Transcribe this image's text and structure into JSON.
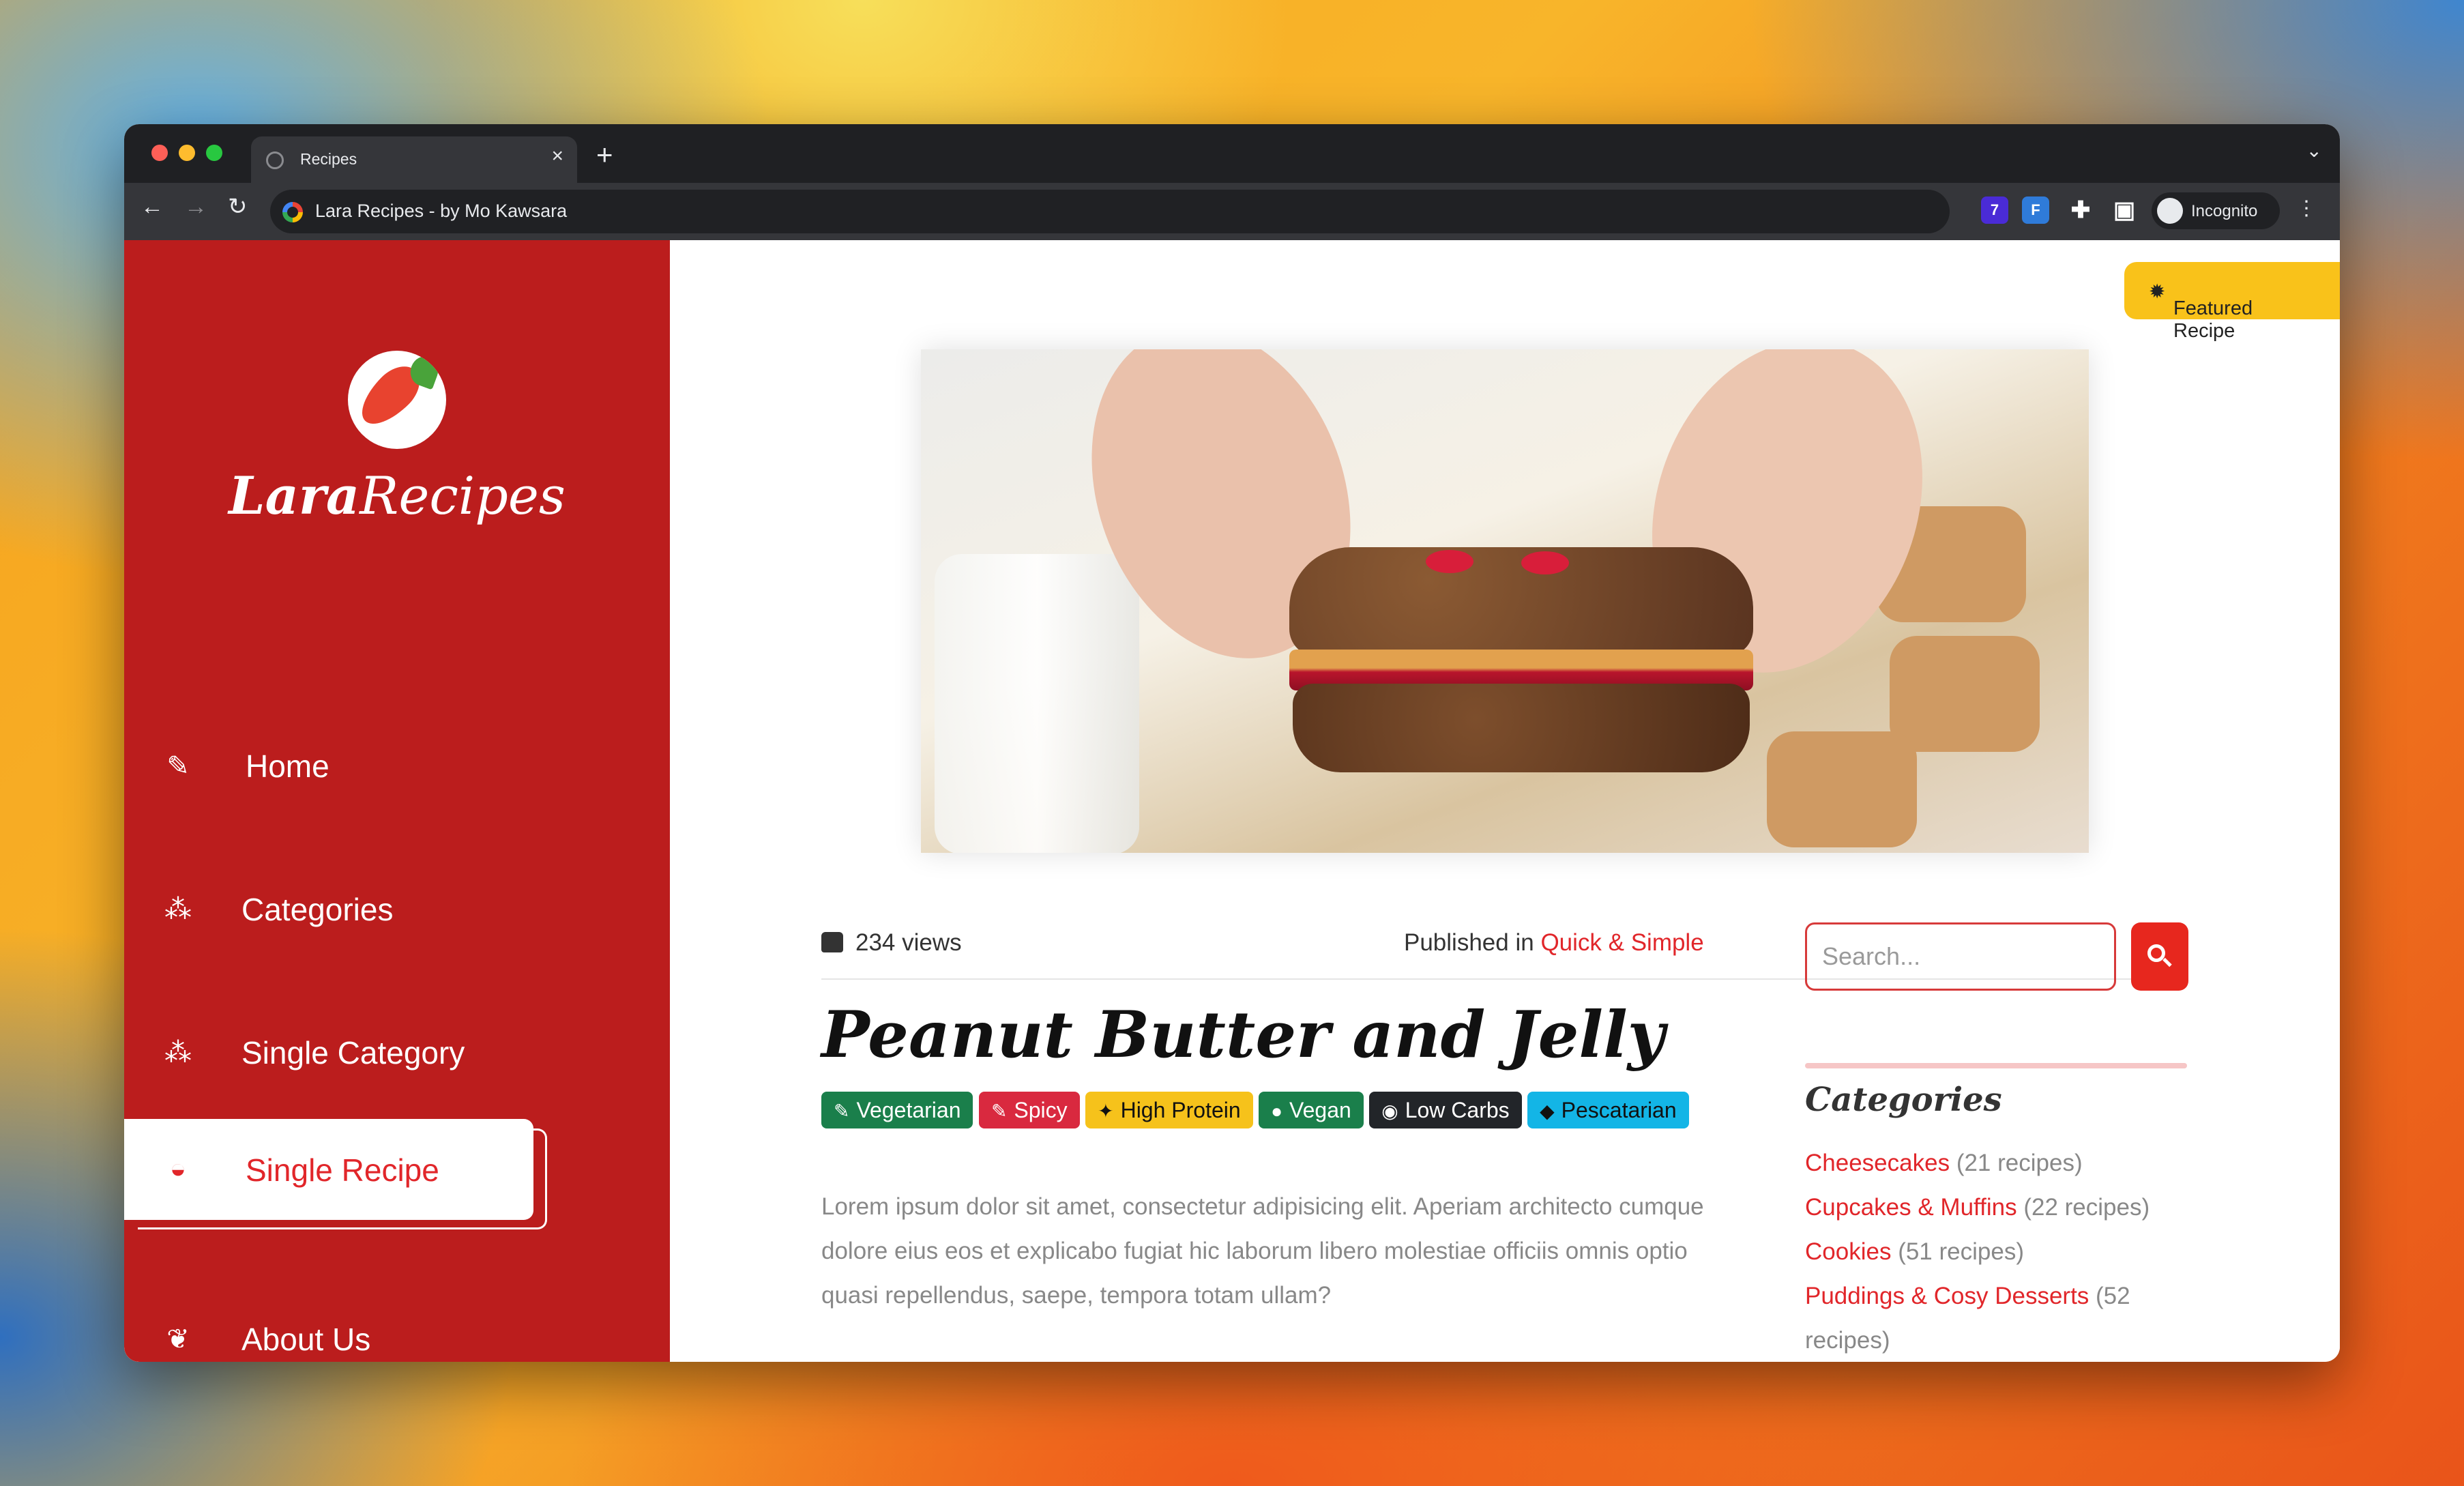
{
  "browser": {
    "tab_title": "Recipes",
    "new_tab": "+",
    "tab_close": "×",
    "address": "Lara Recipes - by Mo Kawsara",
    "incognito_label": "Incognito",
    "extensions": [
      {
        "name": "extension-badge",
        "label": "7",
        "color": "#4a2bd6"
      },
      {
        "name": "extension-fl",
        "label": "F",
        "color": "#2f7bd9"
      }
    ]
  },
  "sidebar": {
    "brand_bold": "Lara",
    "brand_regular": "Recipes",
    "items": [
      {
        "label": "Home",
        "icon": "carrot-icon",
        "glyph": "✎"
      },
      {
        "label": "Categories",
        "icon": "sitemap-icon",
        "glyph": "⁂"
      },
      {
        "label": "Single Category",
        "icon": "sitemap-icon",
        "glyph": "⁂"
      },
      {
        "label": "Single Recipe",
        "icon": "burger-icon",
        "glyph": "◒",
        "active": true
      },
      {
        "label": "About Us",
        "icon": "leaf-icon",
        "glyph": "❦"
      }
    ]
  },
  "featured": "Featured Recipe",
  "recipe": {
    "views": "234 views",
    "published_prefix": "Published in",
    "published_category": "Quick & Simple",
    "title": "Peanut Butter and Jelly",
    "badges": [
      {
        "label": "Vegetarian",
        "color": "#1a7f4b",
        "text_color": "#ffffff",
        "icon": "carrot-icon",
        "glyph": "✎"
      },
      {
        "label": "Spicy",
        "color": "#d9293f",
        "text_color": "#ffffff",
        "icon": "pepper-icon",
        "glyph": "✎"
      },
      {
        "label": "High Protein",
        "color": "#f6c21b",
        "text_color": "#111111",
        "icon": "drumstick-icon",
        "glyph": "✦"
      },
      {
        "label": "Vegan",
        "color": "#1a7f4b",
        "text_color": "#ffffff",
        "icon": "apple-icon",
        "glyph": "●"
      },
      {
        "label": "Low Carbs",
        "color": "#222529",
        "text_color": "#ffffff",
        "icon": "fire-icon",
        "glyph": "◉"
      },
      {
        "label": "Pescatarian",
        "color": "#13b5e6",
        "text_color": "#111111",
        "icon": "fish-icon",
        "glyph": "◆"
      }
    ],
    "lead": "Lorem ipsum dolor sit amet, consectetur adipisicing elit. Aperiam architecto cumque dolore eius eos et explicabo fugiat hic laborum libero molestiae officiis omnis optio quasi repellendus, saepe, tempora totam ullam?"
  },
  "search": {
    "placeholder": "Search..."
  },
  "categories": {
    "title": "Categories",
    "items": [
      {
        "name": "Cheesecakes",
        "count": "(21 recipes)"
      },
      {
        "name": "Cupcakes & Muffins",
        "count": "(22 recipes)"
      },
      {
        "name": "Cookies",
        "count": "(51 recipes)"
      },
      {
        "name": "Puddings & Cosy Desserts",
        "count": "(52 recipes)"
      }
    ]
  }
}
